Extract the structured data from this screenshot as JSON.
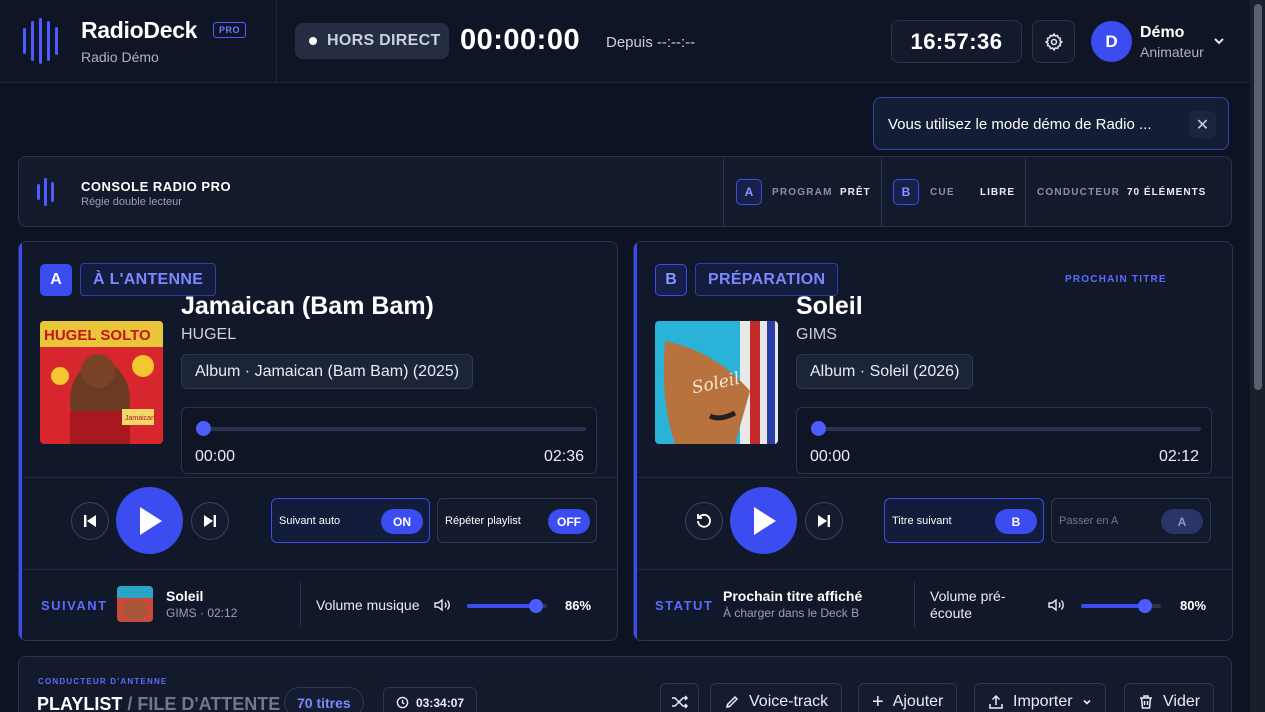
{
  "header": {
    "brand": "RadioDeck",
    "badge": "PRO",
    "station": "Radio Démo",
    "live_status": "HORS DIRECT",
    "timer": "00:00:00",
    "since": "Depuis --:--:--",
    "clock": "16:57:36",
    "user": {
      "initial": "D",
      "name": "Démo",
      "role": "Animateur"
    }
  },
  "toast": {
    "message": "Vous utilisez le mode démo de Radio ...",
    "close_icon": "close-icon"
  },
  "console": {
    "title": "CONSOLE RADIO PRO",
    "subtitle": "Régie double lecteur",
    "program": {
      "letter": "A",
      "label": "PROGRAM",
      "status": "PRÊT"
    },
    "cue": {
      "letter": "B",
      "label": "CUE",
      "status": "LIBRE"
    },
    "rundown": {
      "label": "CONDUCTEUR",
      "value": "70 ÉLÉMENTS"
    }
  },
  "deck_a": {
    "letter": "A",
    "tag": "À L'ANTENNE",
    "title": "Jamaican (Bam Bam)",
    "artist": "HUGEL",
    "album": "Album · Jamaican (Bam Bam) (2025)",
    "cover_text_top": "HUGEL  SOLTO",
    "cover_text_small": "Jamaican",
    "time_current": "00:00",
    "time_total": "02:36",
    "progress": 0,
    "auto_next": {
      "label": "Suivant auto",
      "state": "ON"
    },
    "repeat": {
      "label": "Répéter playlist",
      "state": "OFF"
    },
    "next_label": "SUIVANT",
    "next_title": "Soleil",
    "next_meta": "GIMS · 02:12",
    "volume_label": "Volume musique",
    "volume": 86,
    "volume_text": "86%"
  },
  "deck_b": {
    "letter": "B",
    "tag": "PRÉPARATION",
    "side_label": "PROCHAIN TITRE",
    "title": "Soleil",
    "artist": "GIMS",
    "album": "Album · Soleil (2026)",
    "cover_text": "Soleil",
    "time_current": "00:00",
    "time_total": "02:12",
    "progress": 0,
    "next_track": {
      "label": "Titre suivant",
      "state": "B"
    },
    "pass_a": {
      "label": "Passer en A",
      "state": "A"
    },
    "status_label": "STATUT",
    "status_title": "Prochain titre affiché",
    "status_sub": "À charger dans le Deck B",
    "volume_label_1": "Volume pré-",
    "volume_label_2": "écoute",
    "volume": 80,
    "volume_text": "80%"
  },
  "playlist": {
    "kicker": "CONDUCTEUR D'ANTENNE",
    "title": "PLAYLIST",
    "title_sep": " / ",
    "title_rest": "FILE D'ATTENTE",
    "count": "70 titres",
    "duration": "03:34:07",
    "buttons": {
      "voice": "Voice-track",
      "add": "Ajouter",
      "import": "Importer",
      "clear": "Vider"
    }
  },
  "colors": {
    "accent": "#3b4cf0",
    "background": "#0d1322",
    "panel": "#121a2c"
  }
}
